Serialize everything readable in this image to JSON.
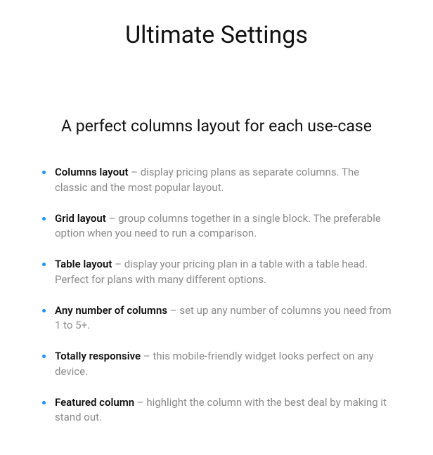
{
  "title": "Ultimate Settings",
  "subtitle": "A perfect columns layout for each use-case",
  "features": [
    {
      "term": "Columns layout",
      "desc": " – display pricing plans as separate columns. The classic and the most popular layout."
    },
    {
      "term": "Grid layout",
      "desc": " – group columns together in a single block. The preferable option when you need to run a comparison."
    },
    {
      "term": "Table layout",
      "desc": " – display your pricing plan in a table with a table head. Perfect for plans with many different options."
    },
    {
      "term": "Any number of columns",
      "desc": " – set up any number of columns you need from 1 to 5+."
    },
    {
      "term": "Totally responsive",
      "desc": " – this mobile-friendly widget looks perfect on any device."
    },
    {
      "term": "Featured column",
      "desc": " – highlight the column with the best deal by making it stand out."
    }
  ],
  "accent_color": "#1e90ff"
}
